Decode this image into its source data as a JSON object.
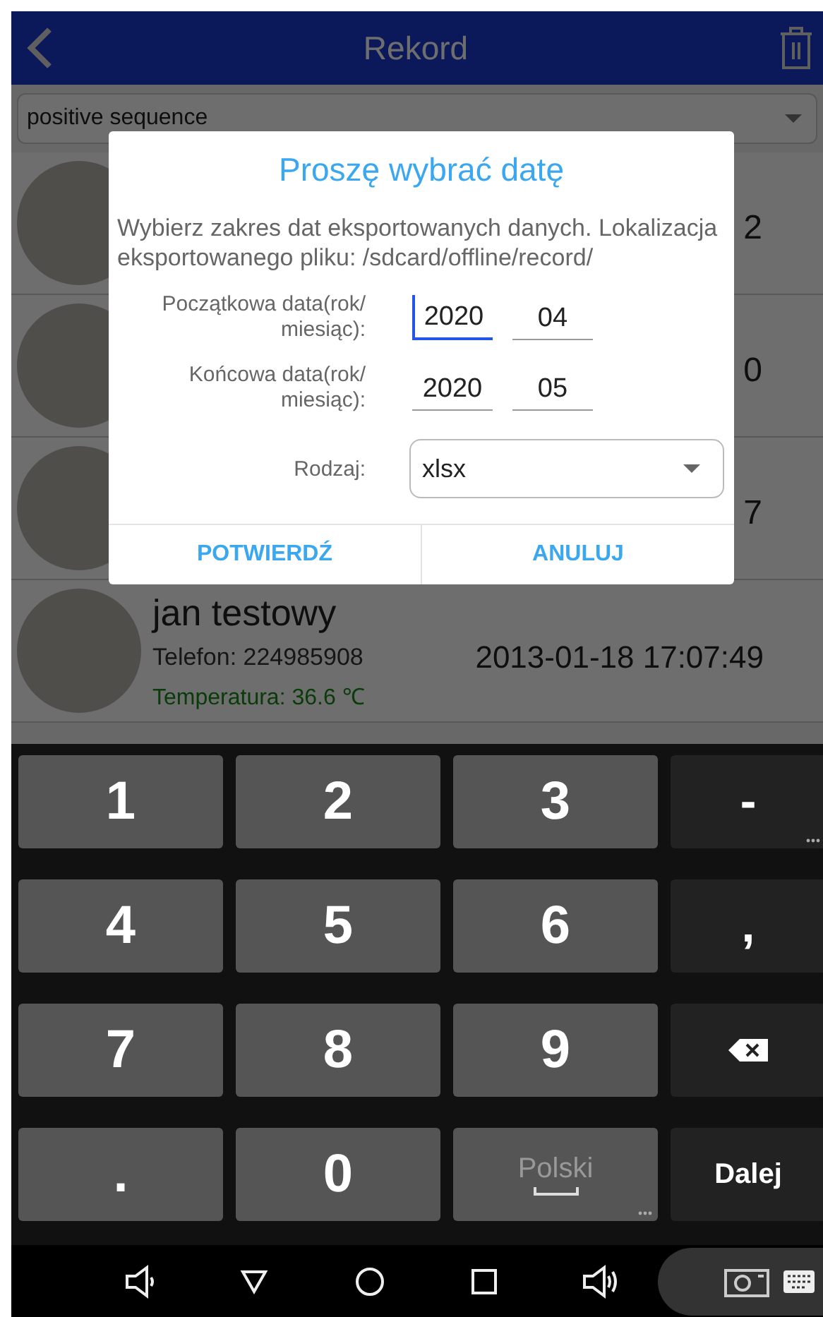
{
  "header": {
    "title": "Rekord"
  },
  "filter": {
    "value": "positive sequence"
  },
  "records": [
    {
      "time": "2"
    },
    {
      "time": "0"
    },
    {
      "time": "7"
    },
    {
      "name": "jan testowy",
      "phone": "Telefon: 224985908",
      "time": "2013-01-18 17:07:49",
      "temperature": "Temperatura: 36.6 ℃"
    }
  ],
  "dialog": {
    "title": "Proszę wybrać datę",
    "message": "Wybierz zakres dat eksportowanych danych. Lokalizacja eksportowanego pliku: /sdcard/offline/record/",
    "date_rows": [
      {
        "label": "Początkowa data(rok/ miesiąc):",
        "year": {
          "value": "2020",
          "focused": true
        },
        "month": {
          "value": "04",
          "focused": false
        }
      },
      {
        "label": "Końcowa data(rok/ miesiąc):",
        "year": {
          "value": "2020",
          "focused": false
        },
        "month": {
          "value": "05",
          "focused": false
        }
      }
    ],
    "type": {
      "label": "Rodzaj:",
      "value": "xlsx"
    },
    "buttons": [
      "POTWIERDŹ",
      "ANULUJ"
    ]
  },
  "keyboard": {
    "rows": [
      [
        {
          "kind": "key",
          "label": "1"
        },
        {
          "kind": "key",
          "label": "2"
        },
        {
          "kind": "key",
          "label": "3"
        },
        {
          "kind": "func",
          "label": "-",
          "more": true
        }
      ],
      [
        {
          "kind": "key",
          "label": "4"
        },
        {
          "kind": "key",
          "label": "5"
        },
        {
          "kind": "key",
          "label": "6"
        },
        {
          "kind": "func",
          "label": ","
        }
      ],
      [
        {
          "kind": "key",
          "label": "7"
        },
        {
          "kind": "key",
          "label": "8"
        },
        {
          "kind": "key",
          "label": "9"
        },
        {
          "kind": "backspace"
        }
      ],
      [
        {
          "kind": "key",
          "label": "."
        },
        {
          "kind": "key",
          "label": "0"
        },
        {
          "kind": "space",
          "label": "Polski",
          "more": true
        },
        {
          "kind": "func",
          "label": "Dalej"
        }
      ]
    ]
  }
}
